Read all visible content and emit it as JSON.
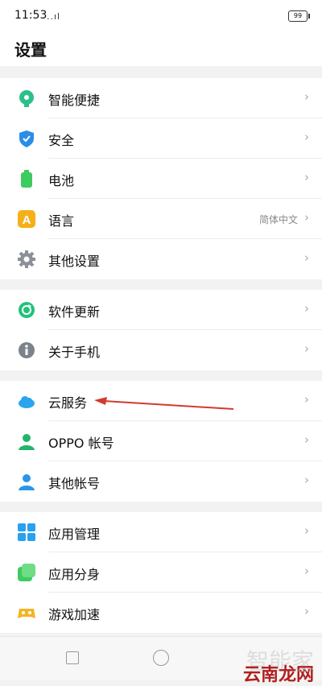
{
  "status_bar": {
    "time": "11:53",
    "signal": "..ıl",
    "battery": "99"
  },
  "header": {
    "title": "设置"
  },
  "sections": [
    {
      "items": [
        {
          "label": "智能便捷",
          "icon": "smart-assist-icon",
          "color": "#2bc08a"
        },
        {
          "label": "安全",
          "icon": "shield-icon",
          "color": "#2b8de8"
        },
        {
          "label": "电池",
          "icon": "battery-icon",
          "color": "#3ecb5f"
        },
        {
          "label": "语言",
          "icon": "language-icon",
          "color": "#f5b019",
          "value": "简体中文"
        },
        {
          "label": "其他设置",
          "icon": "gear-icon",
          "color": "#8a8f99"
        }
      ]
    },
    {
      "items": [
        {
          "label": "软件更新",
          "icon": "update-icon",
          "color": "#22c27a"
        },
        {
          "label": "关于手机",
          "icon": "info-icon",
          "color": "#7b828c"
        }
      ]
    },
    {
      "items": [
        {
          "label": "云服务",
          "icon": "cloud-icon",
          "color": "#2aa4ee"
        },
        {
          "label": "OPPO 帐号",
          "icon": "user-icon",
          "color": "#21b56b"
        },
        {
          "label": "其他帐号",
          "icon": "user-icon",
          "color": "#2b96e8"
        }
      ]
    },
    {
      "items": [
        {
          "label": "应用管理",
          "icon": "apps-grid-icon",
          "color": "#2aa0ef"
        },
        {
          "label": "应用分身",
          "icon": "app-clone-icon",
          "color": "#3ecb5f"
        },
        {
          "label": "游戏加速",
          "icon": "game-icon",
          "color": "#f4b422"
        }
      ]
    }
  ],
  "watermark": {
    "top": "智能家",
    "bottom": "云南龙网",
    "url": ".com"
  }
}
